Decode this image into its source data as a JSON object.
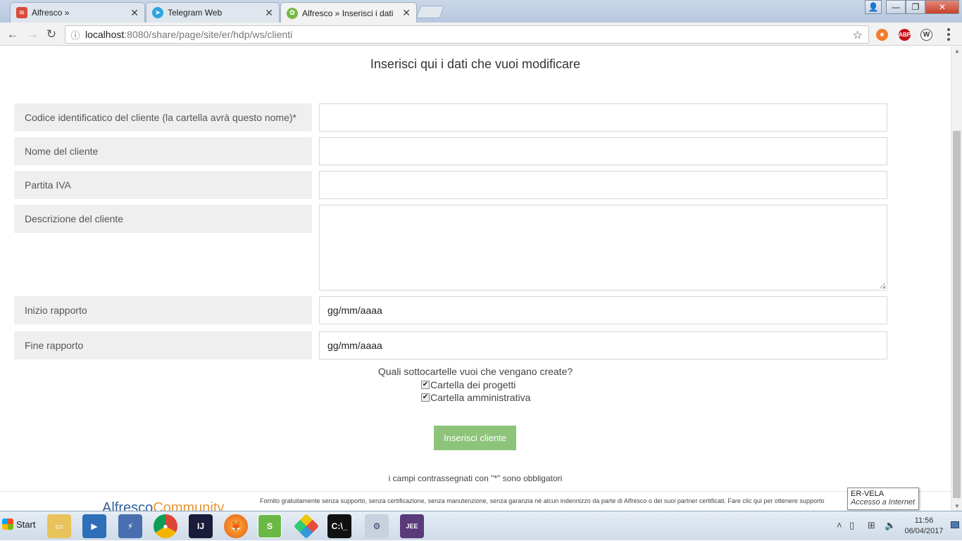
{
  "browser": {
    "tabs": [
      {
        "title": "Alfresco »",
        "active": false,
        "favicon_color": "#d84b3a"
      },
      {
        "title": "Telegram Web",
        "active": false,
        "favicon_color": "#2ca5e0"
      },
      {
        "title": "Alfresco » Inserisci i dati",
        "active": true,
        "favicon_color": "#78b944"
      }
    ],
    "url_host": "localhost",
    "url_path": ":8080/share/page/site/er/hdp/ws/clienti",
    "extensions": [
      "ABP",
      "W"
    ]
  },
  "form": {
    "title": "Inserisci qui i dati che vuoi modificare",
    "fields": [
      {
        "label": "Codice identificatico del cliente (la cartella avrà questo nome)*",
        "value": ""
      },
      {
        "label": "Nome del cliente",
        "value": ""
      },
      {
        "label": "Partita IVA",
        "value": ""
      },
      {
        "label": "Descrizione del cliente",
        "value": ""
      },
      {
        "label": "Inizio rapporto",
        "value": "gg/mm/aaaa"
      },
      {
        "label": "Fine rapporto",
        "value": "gg/mm/aaaa"
      }
    ],
    "question": "Quali sottocartelle vuoi che vengano create?",
    "checkboxes": [
      {
        "label": "Cartella dei progetti",
        "checked": true
      },
      {
        "label": "Cartella amministrativa",
        "checked": true
      }
    ],
    "submit_label": "Inserisci cliente",
    "required_note": "i campi contrassegnati con \"*\" sono obbligatori"
  },
  "footer": {
    "disclaimer": "Fornito gratuitamente senza supporto, senza certificazione, senza manutenzione, senza garanzia né alcun indennizzo da parte di Alfresco o dei suoi partner certificati. Fare clic qui per ottenere supporto"
  },
  "tooltip": {
    "title": "ER-VELA",
    "subtitle": "Accesso a Internet"
  },
  "taskbar": {
    "start_label": "Start",
    "time": "11:56",
    "date": "06/04/2017"
  }
}
